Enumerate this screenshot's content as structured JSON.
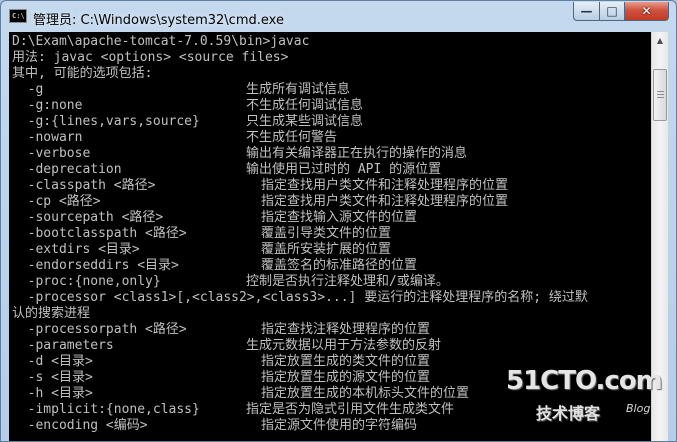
{
  "window": {
    "title": "管理员: C:\\Windows\\system32\\cmd.exe",
    "icon_text": "C:\\",
    "buttons": {
      "minimize": "—",
      "maximize": "□",
      "close": "✕"
    }
  },
  "console": {
    "lines": [
      {
        "text": "D:\\Exam\\apache-tomcat-7.0.59\\bin>javac"
      },
      {
        "text": "用法: javac <options> <source files>"
      },
      {
        "text": "其中, 可能的选项包括:"
      },
      {
        "option": "  -g",
        "desc": "生成所有调试信息",
        "col": 234
      },
      {
        "option": "  -g:none",
        "desc": "不生成任何调试信息",
        "col": 234
      },
      {
        "option": "  -g:{lines,vars,source}",
        "desc": "只生成某些调试信息",
        "col": 234
      },
      {
        "option": "  -nowarn",
        "desc": "不生成任何警告",
        "col": 234
      },
      {
        "option": "  -verbose",
        "desc": "输出有关编译器正在执行的操作的消息",
        "col": 234
      },
      {
        "option": "  -deprecation",
        "desc": "输出使用已过时的 API 的源位置",
        "col": 234
      },
      {
        "option": "  -classpath <路径>",
        "desc": "指定查找用户类文件和注释处理程序的位置",
        "col": 249
      },
      {
        "option": "  -cp <路径>",
        "desc": "指定查找用户类文件和注释处理程序的位置",
        "col": 249
      },
      {
        "option": "  -sourcepath <路径>",
        "desc": "指定查找输入源文件的位置",
        "col": 249
      },
      {
        "option": "  -bootclasspath <路径>",
        "desc": "覆盖引导类文件的位置",
        "col": 249
      },
      {
        "option": "  -extdirs <目录>",
        "desc": "覆盖所安装扩展的位置",
        "col": 249
      },
      {
        "option": "  -endorseddirs <目录>",
        "desc": "覆盖签名的标准路径的位置",
        "col": 249
      },
      {
        "option": "  -proc:{none,only}",
        "desc": "控制是否执行注释处理和/或编译。",
        "col": 234
      },
      {
        "text": "  -processor <class1>[,<class2>,<class3>...] 要运行的注释处理程序的名称; 绕过默"
      },
      {
        "text": "认的搜索进程"
      },
      {
        "option": "  -processorpath <路径>",
        "desc": "指定查找注释处理程序的位置",
        "col": 249
      },
      {
        "option": "  -parameters",
        "desc": "生成元数据以用于方法参数的反射",
        "col": 234
      },
      {
        "option": "  -d <目录>",
        "desc": "指定放置生成的类文件的位置",
        "col": 249
      },
      {
        "option": "  -s <目录>",
        "desc": "指定放置生成的源文件的位置",
        "col": 249
      },
      {
        "option": "  -h <目录>",
        "desc": "指定放置生成的本机标头文件的位置",
        "col": 249
      },
      {
        "option": "  -implicit:{none,class}",
        "desc": "指定是否为隐式引用文件生成类文件",
        "col": 234
      },
      {
        "option": "  -encoding <编码>",
        "desc": "指定源文件使用的字符编码",
        "col": 249
      }
    ]
  },
  "watermark": {
    "main": "51CTO.com",
    "sub": "技术博客",
    "blog": "Blog"
  }
}
